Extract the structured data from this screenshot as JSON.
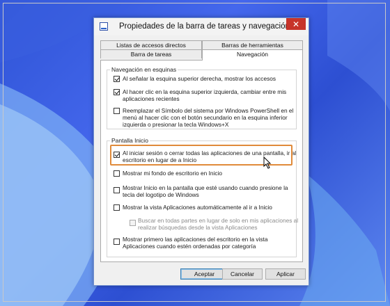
{
  "window": {
    "title": "Propiedades de la barra de tareas y navegación",
    "close_glyph": "✕"
  },
  "tabs": {
    "row1": [
      "Listas de accesos directos",
      "Barras de herramientas"
    ],
    "row2": [
      "Barra de tareas",
      "Navegación"
    ],
    "active": "Navegación"
  },
  "corner_nav": {
    "title": "Navegación en esquinas",
    "options": [
      {
        "label": "Al señalar la esquina superior derecha, mostrar los accesos",
        "checked": true
      },
      {
        "label_lines": [
          "Al hacer clic en la esquina superior izquierda, cambiar entre mis",
          "aplicaciones recientes"
        ],
        "checked": true
      },
      {
        "label_lines": [
          "Reemplazar el Símbolo del sistema por Windows PowerShell en el",
          "menú al hacer clic con el botón secundario en la esquina inferior",
          "izquierda o presionar la tecla Windows+X"
        ],
        "checked": false
      }
    ]
  },
  "start_screen": {
    "title": "Pantalla Inicio",
    "options": [
      {
        "label_lines": [
          "Al iniciar sesión o cerrar todas las aplicaciones de una pantalla, ir al",
          "escritorio en lugar de a Inicio"
        ],
        "checked": true
      },
      {
        "label": "Mostrar mi fondo de escritorio en Inicio",
        "checked": false
      },
      {
        "label_lines": [
          "Mostrar Inicio en la pantalla que esté usando cuando presione la",
          "tecla del logotipo de Windows"
        ],
        "checked": false
      },
      {
        "label": "Mostrar la vista Aplicaciones automáticamente al ir a Inicio",
        "checked": false
      },
      {
        "label_lines": [
          "Buscar en todas partes en lugar de solo en mis aplicaciones al",
          "realizar búsquedas desde la vista Aplicaciones"
        ],
        "checked": false,
        "disabled": true
      },
      {
        "label_lines": [
          "Mostrar primero las aplicaciones del escritorio en la vista",
          "Aplicaciones cuando estén ordenadas por categoría"
        ],
        "checked": false
      }
    ]
  },
  "buttons": {
    "ok": "Aceptar",
    "cancel": "Cancelar",
    "apply": "Aplicar"
  },
  "colors": {
    "close_button": "#c7342a",
    "highlight": "#e08a3a",
    "desktop": "#2f54d6"
  }
}
